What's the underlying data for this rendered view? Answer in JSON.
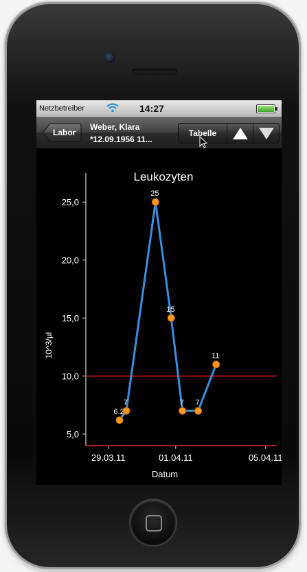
{
  "status": {
    "carrier": "Netzbetreiber",
    "time": "14:27"
  },
  "navbar": {
    "back_label": "Labor",
    "patient_name": "Weber, Klara",
    "patient_dob": "*12.09.1956 11...",
    "table_label": "Tabelle",
    "up_icon": "triangle-up-icon",
    "down_icon": "triangle-down-icon"
  },
  "colors": {
    "line": "#3a8fe0",
    "point": "#ff9a1f",
    "limit": "#c0141e",
    "text": "#ffffff"
  },
  "chart_data": {
    "type": "line",
    "title": "Leukozyten",
    "xlabel": "Datum",
    "ylabel": "10^3/µl",
    "x_ticks": [
      "29.03.11",
      "01.04.11",
      "05.04.11"
    ],
    "x_tick_days": [
      0,
      3,
      7
    ],
    "xlim": [
      -1.0,
      7.5
    ],
    "y_ticks": [
      "5,0",
      "10,0",
      "15,0",
      "20,0",
      "25,0"
    ],
    "ylim": [
      4.0,
      27.5
    ],
    "series": [
      {
        "x": [
          0.5,
          0.8,
          2.1,
          2.8,
          3.3,
          4.0,
          4.8
        ],
        "values": [
          6.2,
          7,
          25,
          15,
          7,
          7,
          11
        ],
        "labels": [
          "6.2",
          "7",
          "25",
          "15",
          "7",
          "7",
          "11"
        ]
      }
    ],
    "reference_lines": [
      10.0,
      4.0
    ]
  }
}
